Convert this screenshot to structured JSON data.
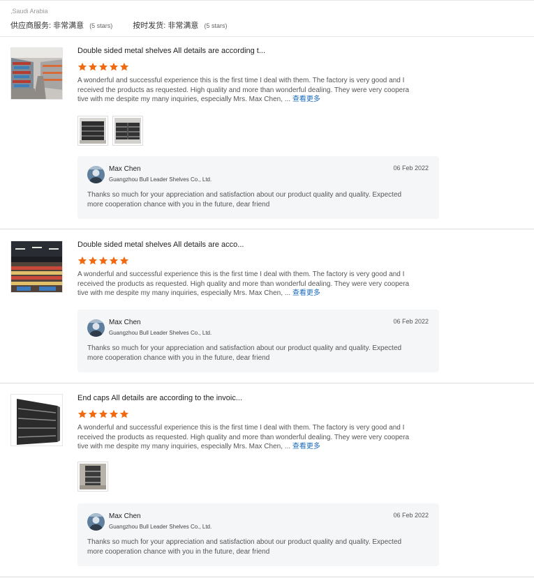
{
  "header": {
    "country": ",Saudi Arabia",
    "service_label": "供应商服务:",
    "service_value": "非常满意",
    "service_stars": "(5 stars)",
    "shipping_label": "按时发货:",
    "shipping_value": "非常满意",
    "shipping_stars": "(5 stars)"
  },
  "colors": {
    "star": "#f26a10",
    "link": "#1a6bbd",
    "reply_bg": "#f5f6f8"
  },
  "reviews": [
    {
      "title": "Double sided metal shelves All details are according t...",
      "rating": 5,
      "lines": [
        "A wonderful and successful experience this is the first time I deal with them. The factory is very good and I",
        "received the products as requested. High quality and more than wonderful dealing. They were very coopera",
        "tive with me despite my many inquiries, especially Mrs. Max Chen, ..."
      ],
      "more": "查看更多",
      "attachment_count": 2,
      "reply": {
        "name": "Max Chen",
        "company": "Guangzhou Bull Leader Shelves Co., Ltd.",
        "date": "06 Feb 2022",
        "line1": "Thanks so much for your appreciation and satisfaction about our product quality and quality. Expected",
        "line2": "more  cooperation chance with you in the future, dear friend"
      }
    },
    {
      "title": "Double sided metal shelves All details are acco...",
      "rating": 5,
      "lines": [
        "A wonderful and successful experience this is the first time I deal with them. The factory is very good and I",
        "received the products as requested. High quality and more than wonderful dealing. They were very coopera",
        "tive with me despite my many inquiries, especially Mrs. Max Chen, ..."
      ],
      "more": "查看更多",
      "attachment_count": 0,
      "reply": {
        "name": "Max Chen",
        "company": "Guangzhou Bull Leader Shelves Co., Ltd.",
        "date": "06 Feb 2022",
        "line1": "Thanks so much for your appreciation and satisfaction about our product quality and quality. Expected",
        "line2": "more  cooperation chance with you in the future, dear friend"
      }
    },
    {
      "title": "End caps All details are according to the invoic...",
      "rating": 5,
      "lines": [
        "A wonderful and successful experience this is the first time I deal with them. The factory is very good and I",
        "received the products as requested. High quality and more than wonderful dealing. They were very coopera",
        "tive with me despite my many inquiries, especially Mrs. Max Chen, ..."
      ],
      "more": "查看更多",
      "attachment_count": 1,
      "reply": {
        "name": "Max Chen",
        "company": "Guangzhou Bull Leader Shelves Co., Ltd.",
        "date": "06 Feb 2022",
        "line1": "Thanks so much for your appreciation and satisfaction about our product quality and quality. Expected",
        "line2": "more  cooperation chance with you in the future, dear friend"
      }
    }
  ]
}
